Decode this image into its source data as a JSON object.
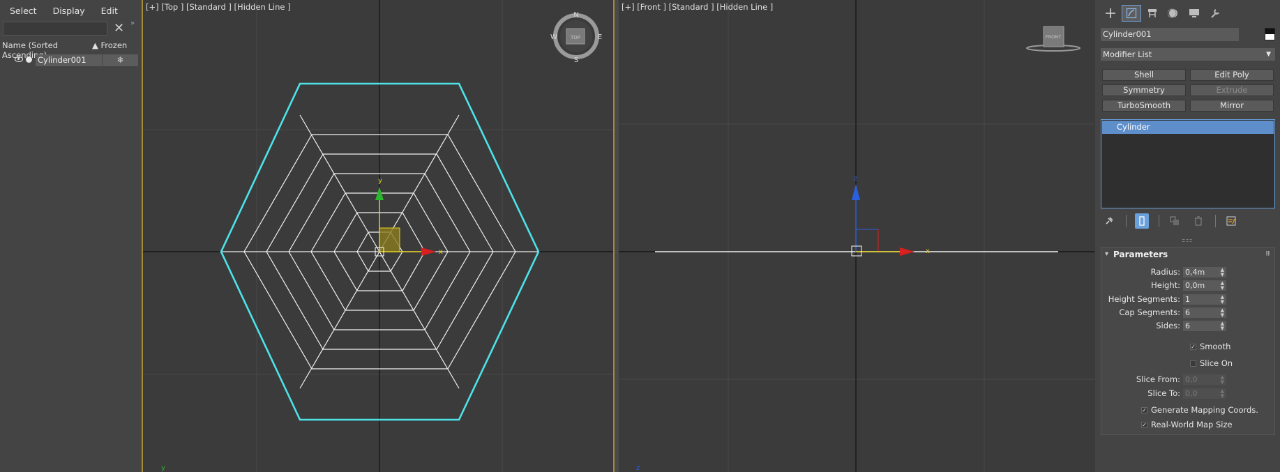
{
  "menu": {
    "select": "Select",
    "display": "Display",
    "edit": "Edit"
  },
  "explorer": {
    "search_value": "",
    "clear_glyph": "✕",
    "expand_glyph": "»",
    "col_name": "Name (Sorted Ascending)",
    "col_frozen": "▲ Frozen",
    "rows": [
      {
        "name": "Cylinder001",
        "frozen_icon": "❄"
      }
    ]
  },
  "viewports": {
    "top": {
      "label": "[+] [Top ] [Standard ] [Hidden Line ]",
      "axis_x": "x",
      "axis_y": "y",
      "corner_axis": "y",
      "compass": {
        "n": "N",
        "s": "S",
        "e": "E",
        "w": "W",
        "cube": "TOP"
      }
    },
    "front": {
      "label": "[+] [Front ] [Standard ] [Hidden Line ]",
      "axis_x": "x",
      "axis_z": "z",
      "corner_axis": "z",
      "cube": "FRONT"
    }
  },
  "panel": {
    "object_name": "Cylinder001",
    "modifier_list": "Modifier List",
    "buttons": [
      "Shell",
      "Edit Poly",
      "Symmetry",
      "Extrude",
      "TurboSmooth",
      "Mirror"
    ],
    "stack_item": "Cylinder",
    "params_title": "Parameters",
    "params": [
      {
        "label": "Radius:",
        "value": "0,4m"
      },
      {
        "label": "Height:",
        "value": "0,0m"
      },
      {
        "label": "Height Segments:",
        "value": "1"
      },
      {
        "label": "Cap Segments:",
        "value": "6"
      },
      {
        "label": "Sides:",
        "value": "6"
      }
    ],
    "smooth": "Smooth",
    "slice_on": "Slice On",
    "slice_from": {
      "label": "Slice From:",
      "value": "0,0"
    },
    "slice_to": {
      "label": "Slice To:",
      "value": "0,0"
    },
    "gen_mapping": "Generate Mapping Coords.",
    "real_world": "Real-World Map Size"
  },
  "colors": {
    "selection": "#4de3e8",
    "accent": "#6aa0dc",
    "viewport_border": "#a48a35",
    "axis_x": "#d92020",
    "axis_y": "#2cb82c",
    "axis_z": "#2b5fe0"
  }
}
